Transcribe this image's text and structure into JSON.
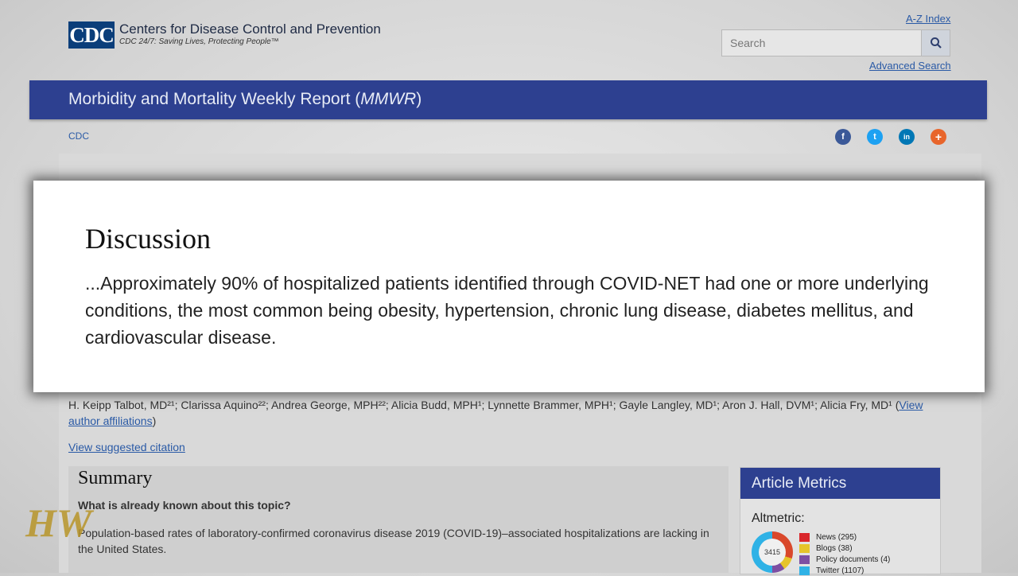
{
  "header": {
    "logo_text": "CDC",
    "org_name": "Centers for Disease Control and Prevention",
    "tagline": "CDC 24/7: Saving Lives, Protecting People™",
    "az_index": "A-Z Index",
    "search_placeholder": "Search",
    "advanced_search": "Advanced Search"
  },
  "banner": {
    "title_prefix": "Morbidity and Mortality Weekly Report (",
    "title_abbr": "MMWR",
    "title_suffix": ")"
  },
  "breadcrumb": "CDC",
  "social": [
    {
      "name": "facebook-icon",
      "glyph": "f",
      "color": "#3b5998"
    },
    {
      "name": "twitter-icon",
      "glyph": "t",
      "color": "#1da1f2"
    },
    {
      "name": "linkedin-icon",
      "glyph": "in",
      "color": "#0077b5"
    },
    {
      "name": "share-icon",
      "glyph": "+",
      "color": "#e8652b"
    }
  ],
  "authors": {
    "text": "H. Keipp Talbot, MD²¹; Clarissa Aquino²²; Andrea George, MPH²²; Alicia Budd, MPH¹; Lynnette Brammer, MPH¹; Gayle Langley, MD¹; Aron J. Hall, DVM¹; Alicia Fry, MD¹ (",
    "link": "View author affiliations",
    "close": ")"
  },
  "view_citation": "View suggested citation",
  "summary": {
    "title": "Summary",
    "question": "What is already known about this topic?",
    "answer": "Population-based rates of laboratory-confirmed coronavirus disease 2019 (COVID-19)–associated hospitalizations are lacking in the United States."
  },
  "metrics": {
    "header": "Article Metrics",
    "altmetric_label": "Altmetric:",
    "score": "3415",
    "items": [
      {
        "label": "News (295)",
        "color": "#d9262b"
      },
      {
        "label": "Blogs (38)",
        "color": "#e6c42b"
      },
      {
        "label": "Policy documents (4)",
        "color": "#7d4fa3"
      },
      {
        "label": "Twitter (1107)",
        "color": "#2fb2e6"
      }
    ]
  },
  "overlay": {
    "title": "Discussion",
    "text": "...Approximately 90% of hospitalized patients identified through COVID-NET had one or more underlying conditions, the most common being obesity, hypertension, chronic lung disease, diabetes mellitus, and cardiovascular disease."
  },
  "watermark": "HW"
}
